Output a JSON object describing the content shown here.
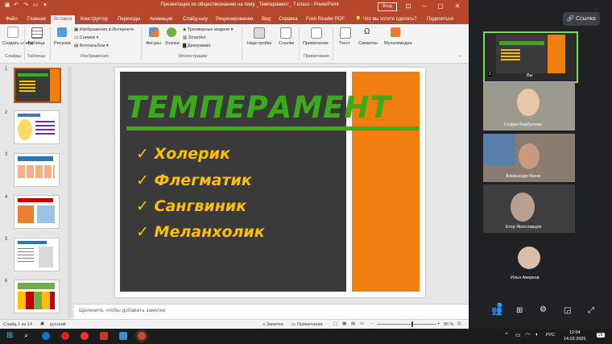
{
  "window": {
    "title": "Презентация по обществознанию на тему _Темперамент_ 7 класс - PowerPoint",
    "sign_in": "Вход"
  },
  "menu": {
    "tabs": [
      "Файл",
      "Главная",
      "Вставка",
      "Конструктор",
      "Переходы",
      "Анимация",
      "Слайд-шоу",
      "Рецензирование",
      "Вид",
      "Справка",
      "Foxit Reader PDF"
    ],
    "search": "Что вы хотите сделать?",
    "share": "Поделиться"
  },
  "ribbon": {
    "new_slide": "Создать слайд",
    "table": "Таблица",
    "images": "Рисунки",
    "online_images": "Изображения в Интернете",
    "screenshot": "Снимок",
    "photo_album": "Фотоальбом",
    "shapes": "Фигуры",
    "icons": "Значки",
    "models3d": "Трехмерные модели",
    "smartart": "SmartArt",
    "chart": "Диаграмма",
    "addins": "Надстройки",
    "links": "Ссылки",
    "comment": "Примечание",
    "text": "Текст",
    "symbols": "Символы",
    "multimedia": "Мультимедиа",
    "groups": {
      "slides": "Слайды",
      "tables": "Таблицы",
      "images": "Изображения",
      "illustrations": "Иллюстрации",
      "comments": "Примечания"
    }
  },
  "thumbnails": [
    "1",
    "2",
    "3",
    "4",
    "5",
    "6"
  ],
  "slide": {
    "title": "ТЕМПЕРАМЕНТ",
    "bullets": [
      "Холерик",
      "Флегматик",
      "Сангвиник",
      "Меланхолик"
    ],
    "bullet_mark": "✓"
  },
  "notes_placeholder": "Щелкните, чтобы добавить заметки",
  "status": {
    "slide_count": "Слайд 1 из 14",
    "language": "русский",
    "notes": "Заметки",
    "comments": "Примечания",
    "zoom": "85 %"
  },
  "meet": {
    "link_button": "Ссылка",
    "self_label": "Вы",
    "participants": [
      "София Барбулова",
      "Александр Мини",
      "Егор Ярославцев",
      "Илья Аверков"
    ]
  },
  "taskbar": {
    "time": "12:04",
    "date": "14.02.2025",
    "lang": "РУС",
    "notif_count": "29"
  },
  "colors": {
    "ppt_accent": "#b7472a",
    "slide_green": "#3bab17",
    "slide_orange": "#f07f10",
    "bullet_yellow": "#ffc000"
  }
}
